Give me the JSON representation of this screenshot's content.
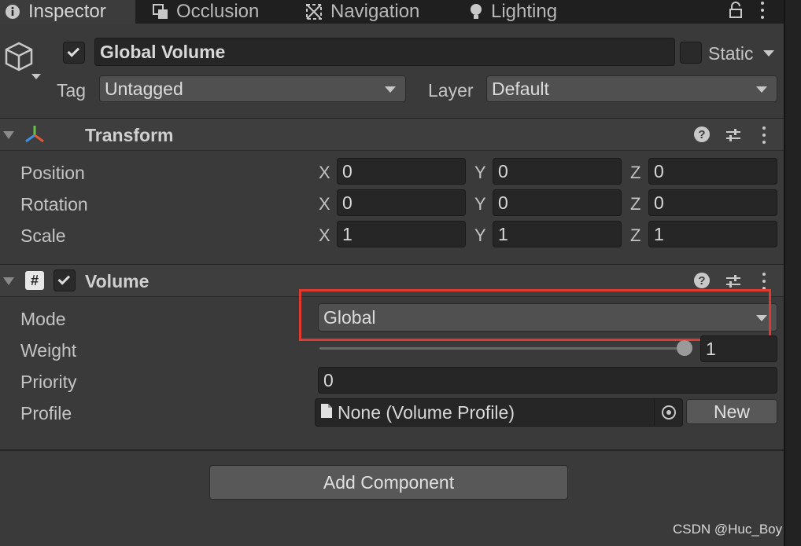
{
  "tabs": [
    {
      "label": "Inspector",
      "icon": "info-icon"
    },
    {
      "label": "Occlusion",
      "icon": "occlusion-icon"
    },
    {
      "label": "Navigation",
      "icon": "navigation-icon"
    },
    {
      "label": "Lighting",
      "icon": "lightbulb-icon"
    }
  ],
  "gameobject": {
    "name": "Global Volume",
    "active": true,
    "static_label": "Static",
    "static": false,
    "tag_label": "Tag",
    "tag_value": "Untagged",
    "layer_label": "Layer",
    "layer_value": "Default"
  },
  "transform": {
    "title": "Transform",
    "rows": [
      {
        "label": "Position",
        "x": "0",
        "y": "0",
        "z": "0"
      },
      {
        "label": "Rotation",
        "x": "0",
        "y": "0",
        "z": "0"
      },
      {
        "label": "Scale",
        "x": "1",
        "y": "1",
        "z": "1"
      }
    ],
    "axis_labels": {
      "x": "X",
      "y": "Y",
      "z": "Z"
    }
  },
  "volume": {
    "title": "Volume",
    "enabled": true,
    "mode_label": "Mode",
    "mode_value": "Global",
    "weight_label": "Weight",
    "weight_value": "1",
    "weight_fraction": 1.0,
    "priority_label": "Priority",
    "priority_value": "0",
    "profile_label": "Profile",
    "profile_value": "None (Volume Profile)",
    "new_button": "New"
  },
  "add_component_label": "Add Component",
  "watermark": "CSDN @Huc_Boy",
  "colors": {
    "highlight": "#e0392f",
    "panel": "#3a3a3a",
    "field": "#262626"
  }
}
